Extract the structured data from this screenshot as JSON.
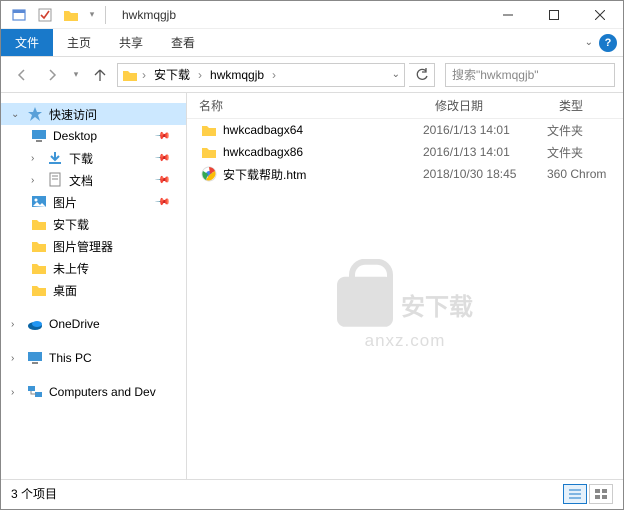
{
  "window": {
    "title": "hwkmqgjb"
  },
  "qat": {
    "items": [
      "properties",
      "check",
      "folder-new"
    ]
  },
  "ribbon": {
    "file": "文件",
    "tabs": [
      "主页",
      "共享",
      "查看"
    ]
  },
  "address": {
    "crumbs": [
      "安下载",
      "hwkmqgjb"
    ]
  },
  "search": {
    "placeholder": "搜索\"hwkmqgjb\""
  },
  "nav": {
    "quick": {
      "label": "快速访问",
      "items": [
        {
          "label": "Desktop",
          "pinned": true,
          "icon": "desktop"
        },
        {
          "label": "下载",
          "pinned": true,
          "icon": "downloads"
        },
        {
          "label": "文档",
          "pinned": true,
          "icon": "docs"
        },
        {
          "label": "图片",
          "pinned": true,
          "icon": "pictures"
        },
        {
          "label": "安下载",
          "pinned": false,
          "icon": "folder"
        },
        {
          "label": "图片管理器",
          "pinned": false,
          "icon": "folder"
        },
        {
          "label": "未上传",
          "pinned": false,
          "icon": "folder"
        },
        {
          "label": "桌面",
          "pinned": false,
          "icon": "folder"
        }
      ]
    },
    "onedrive": "OneDrive",
    "thispc": "This PC",
    "network": "Computers and Dev"
  },
  "columns": {
    "name": "名称",
    "date": "修改日期",
    "type": "类型"
  },
  "files": [
    {
      "name": "hwkcadbagx64",
      "date": "2016/1/13 14:01",
      "type": "文件夹",
      "icon": "folder"
    },
    {
      "name": "hwkcadbagx86",
      "date": "2016/1/13 14:01",
      "type": "文件夹",
      "icon": "folder"
    },
    {
      "name": "安下载帮助.htm",
      "date": "2018/10/30 18:45",
      "type": "360 Chrom",
      "icon": "chrome"
    }
  ],
  "status": {
    "count": "3 个项目"
  },
  "watermark": {
    "cn": "安下载",
    "dom": "anxz.com"
  }
}
